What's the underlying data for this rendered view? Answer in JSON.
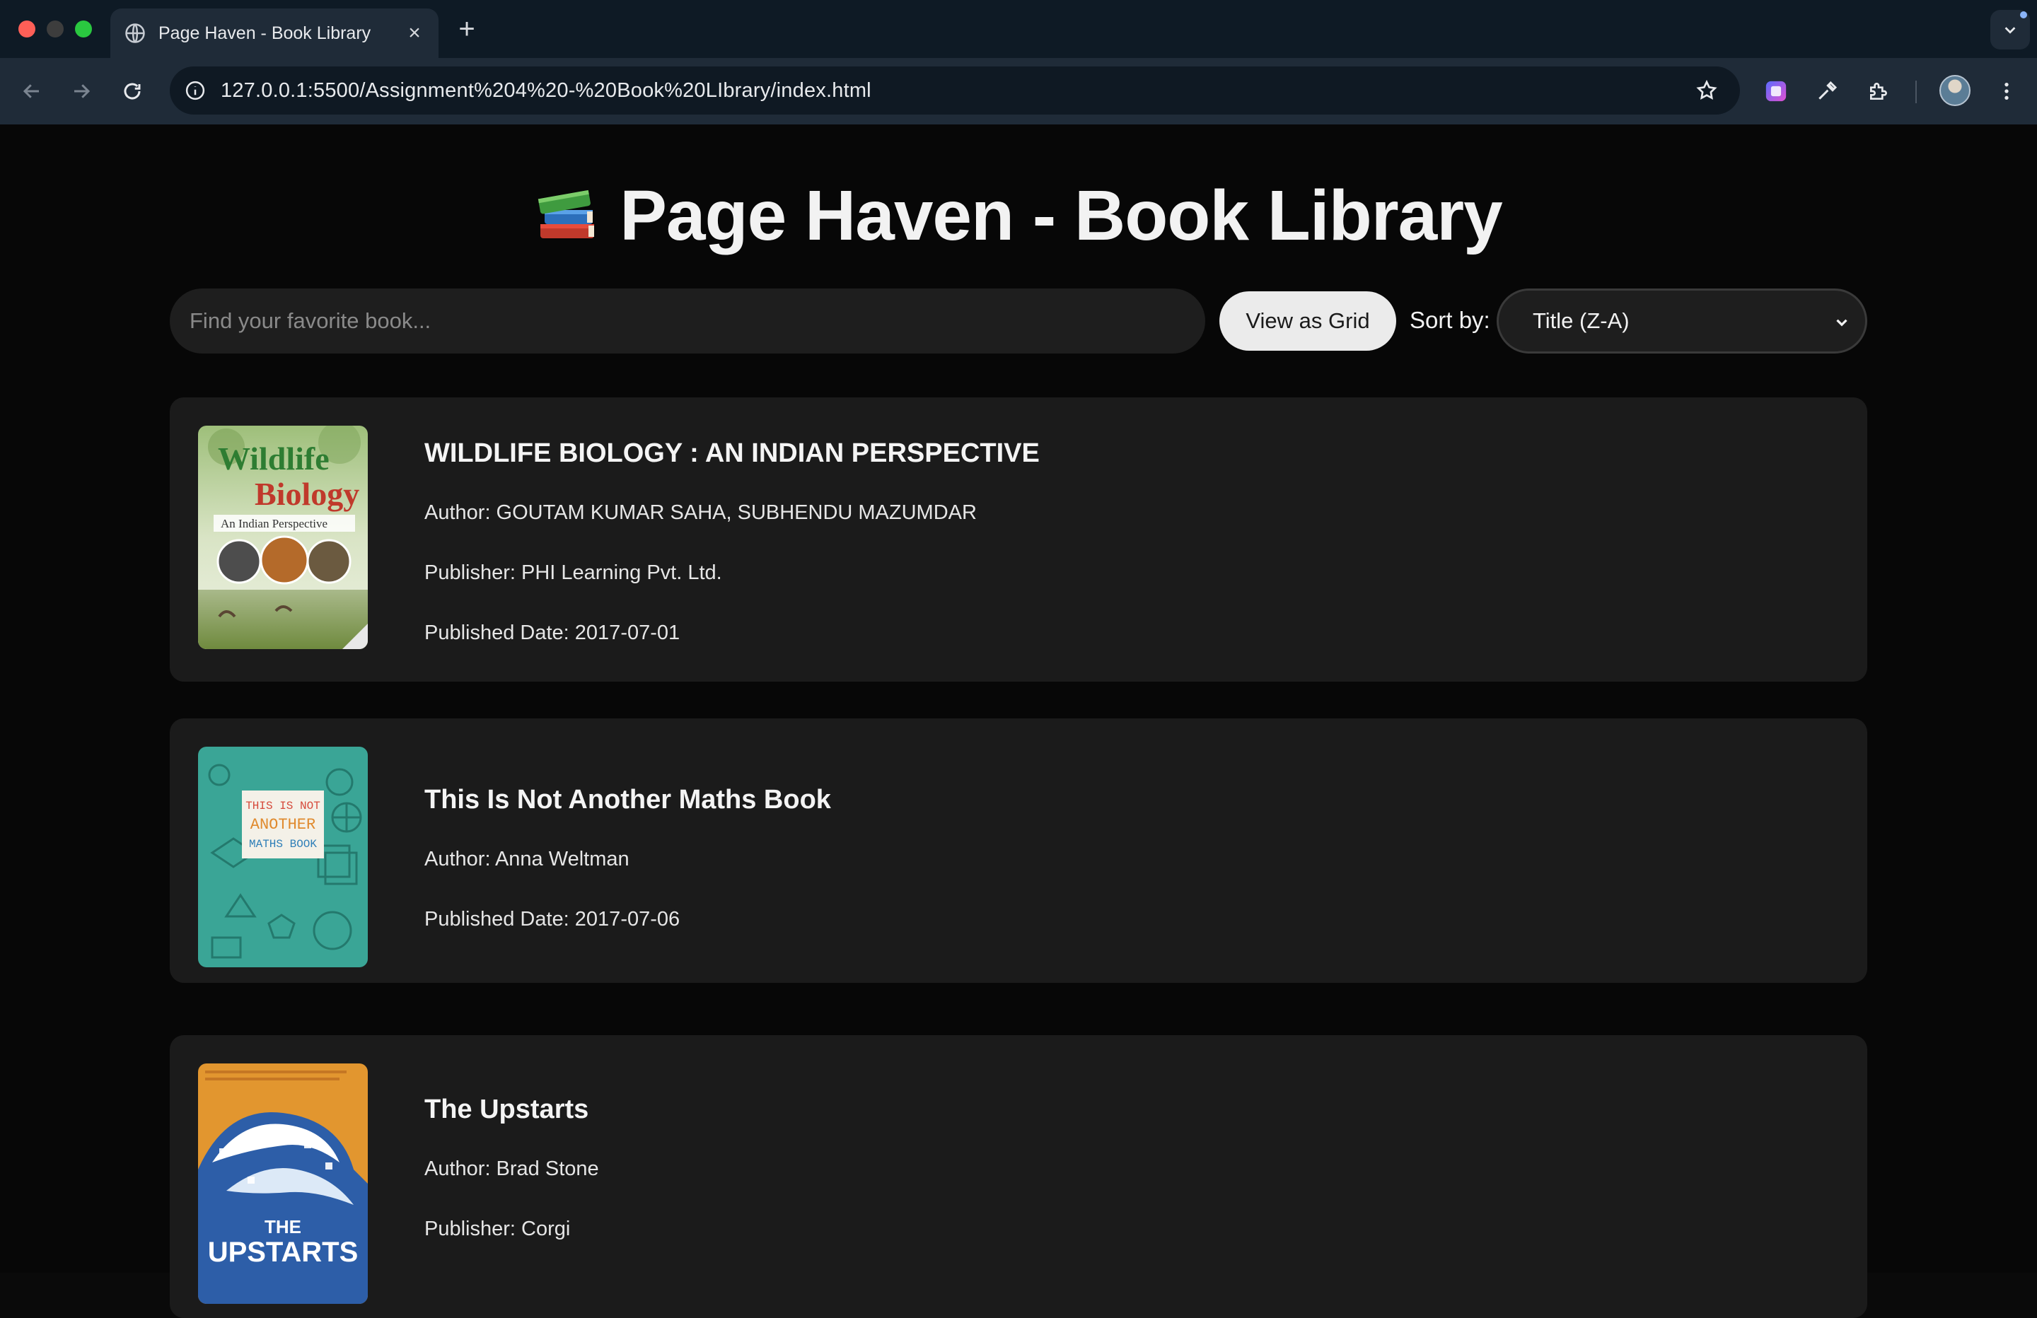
{
  "browser": {
    "tab_title": "Page Haven - Book Library",
    "url": "127.0.0.1:5500/Assignment%204%20-%20Book%20LIbrary/index.html"
  },
  "page": {
    "title": "Page Haven - Book Library",
    "title_icon": "books-icon"
  },
  "controls": {
    "search_placeholder": "Find your favorite book...",
    "search_value": "",
    "view_button": "View as Grid",
    "sort_label": "Sort by:",
    "sort_selected": "Title (Z-A)"
  },
  "books": [
    {
      "title": "WILDLIFE BIOLOGY : AN INDIAN PERSPECTIVE",
      "author": "Author: GOUTAM KUMAR SAHA, SUBHENDU MAZUMDAR",
      "publisher": "Publisher: PHI Learning Pvt. Ltd.",
      "published": "Published Date: 2017-07-01",
      "cover_text": [
        "Wildlife",
        "Biology",
        "An Indian Perspective"
      ]
    },
    {
      "title": "This Is Not Another Maths Book",
      "author": "Author: Anna Weltman",
      "published": "Published Date: 2017-07-06",
      "cover_text": [
        "THIS IS NOT",
        "ANOTHER",
        "MATHS BOOK"
      ]
    },
    {
      "title": "The Upstarts",
      "author": "Author: Brad Stone",
      "publisher": "Publisher: Corgi",
      "cover_text": [
        "THE",
        "UPSTARTS"
      ]
    }
  ],
  "colors": {
    "page_bg": "#070707",
    "card_bg": "#1b1b1b",
    "button_bg": "#ebebeb",
    "cover2_teal": "#3aa596",
    "cover3_orange": "#e2962f"
  }
}
